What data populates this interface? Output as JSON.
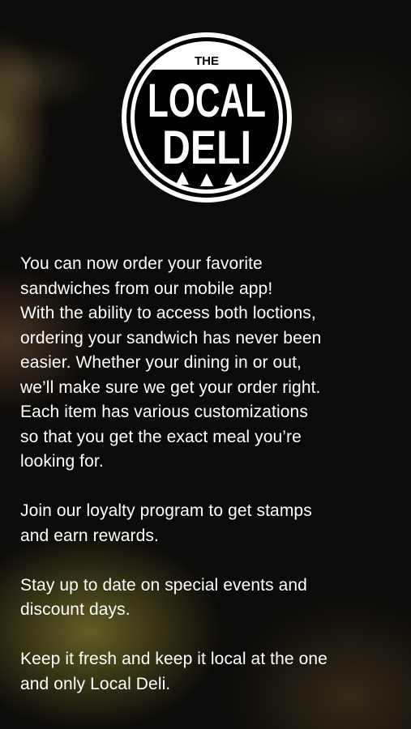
{
  "logo": {
    "small_text": "THE",
    "line1": "LOCAL",
    "line2": "DELI",
    "icon": "three-triangles-icon"
  },
  "content": {
    "paragraphs": [
      "You can now order your favorite\nsandwiches from our mobile app!\nWith the ability to access both loctions,\nordering your sandwich has never been\neasier. Whether your dining in or out,\nwe’ll make sure we get your order right.\nEach item has various customizations\nso that you get the exact meal you’re\nlooking for.",
      "Join our loyalty program to get stamps\nand earn rewards.",
      "Stay up to date on special events and\ndiscount days.",
      "Keep it fresh and keep it local at the one\nand only Local Deli."
    ]
  },
  "colors": {
    "background": "#0c0b09",
    "text": "#ffffff",
    "logo_ring": "#ffffff",
    "logo_fill": "#000000"
  }
}
